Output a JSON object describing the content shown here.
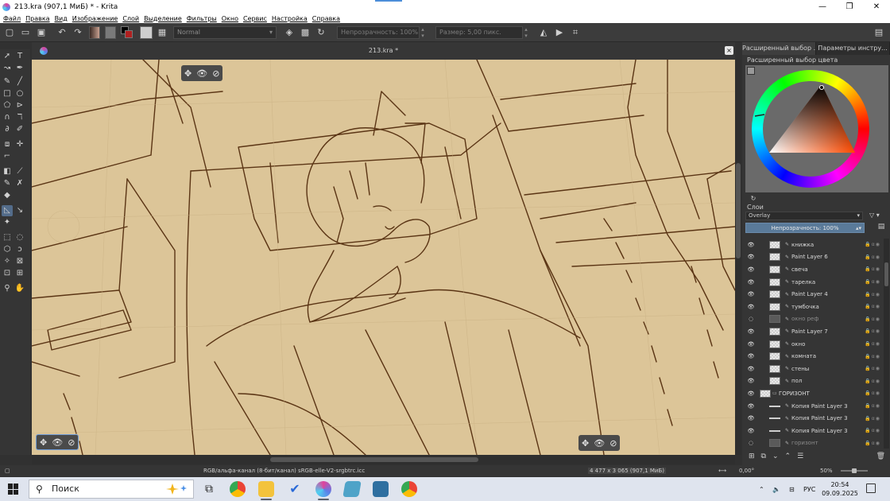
{
  "window": {
    "title": "213.kra (907,1 МиБ)  * - Krita",
    "controls": [
      "—",
      "❐",
      "✕"
    ]
  },
  "menu": [
    "Файл",
    "Правка",
    "Вид",
    "Изображение",
    "Слой",
    "Выделение",
    "Фильтры",
    "Окно",
    "Сервис",
    "Настройка",
    "Справка"
  ],
  "toolbar": {
    "blend_mode": "Normal",
    "opacity": "Непрозрачность: 100%",
    "size": "Размер: 5,00 пикс."
  },
  "document": {
    "tab_title": "213.kra *",
    "close": "×"
  },
  "hud": {
    "move": "✥",
    "eye": "👁",
    "disable": "⊘"
  },
  "dock": {
    "tab_color": "Расширенный выбор ...",
    "tab_tool": "Параметры инстру...",
    "color_title": "Расширенный выбор цвета",
    "layers_title": "Слои",
    "layer_blend": "Overlay",
    "layer_opacity": "Непрозрачность:  100%"
  },
  "layers": [
    {
      "name": "книжка",
      "dim": false
    },
    {
      "name": "Paint Layer 6",
      "dim": false
    },
    {
      "name": "свеча",
      "dim": false
    },
    {
      "name": "тарелка",
      "dim": false
    },
    {
      "name": "Paint Layer 4",
      "dim": false
    },
    {
      "name": "тумбочка",
      "dim": false
    },
    {
      "name": "окно реф",
      "dim": true
    },
    {
      "name": "Paint Layer 7",
      "dim": false
    },
    {
      "name": "окно",
      "dim": false
    },
    {
      "name": "комната",
      "dim": false
    },
    {
      "name": "стены",
      "dim": false
    },
    {
      "name": "пол",
      "dim": false
    },
    {
      "name": "ГОРИЗОНТ",
      "dim": false
    },
    {
      "name": "Копия  Paint Layer 3",
      "dim": false
    },
    {
      "name": "Копия  Paint Layer 3",
      "dim": false
    },
    {
      "name": "Копия  Paint Layer 3",
      "dim": false
    },
    {
      "name": "горизонт",
      "dim": true
    }
  ],
  "status": {
    "color_space": "RGB/альфа-канал (8-бит/канал)   sRGB-elle-V2-srgbtrc.icc",
    "dimensions": "4 477 x 3 065 (907,1 МиБ)",
    "rotation": "0,00°",
    "zoom": "50%"
  },
  "taskbar": {
    "search_placeholder": "Поиск",
    "lang": "РУС",
    "time": "20:54",
    "date": "09.09.2025"
  },
  "colors": {
    "canvas": "#dcc598",
    "lineart": "#5a3414",
    "accent": "#5a7a99"
  }
}
